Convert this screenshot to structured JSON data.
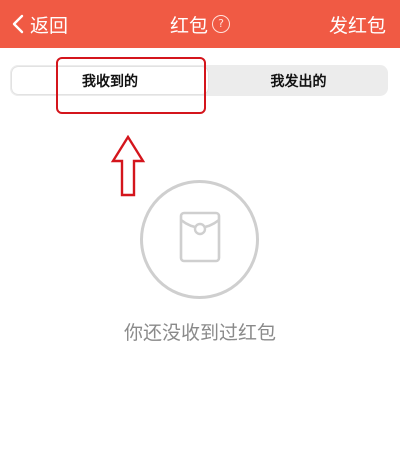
{
  "header": {
    "back_label": "返回",
    "title": "红包",
    "help_icon_glyph": "?",
    "send_label": "发红包",
    "background_color": "#f05a44"
  },
  "tabs": [
    {
      "label": "我收到的",
      "selected": true
    },
    {
      "label": "我发出的",
      "selected": false
    }
  ],
  "empty_state": {
    "icon": "red-packet-icon",
    "message": "你还没收到过红包"
  },
  "annotation": {
    "highlight_color": "#d4151c",
    "arrow_icon": "up-arrow-icon"
  }
}
